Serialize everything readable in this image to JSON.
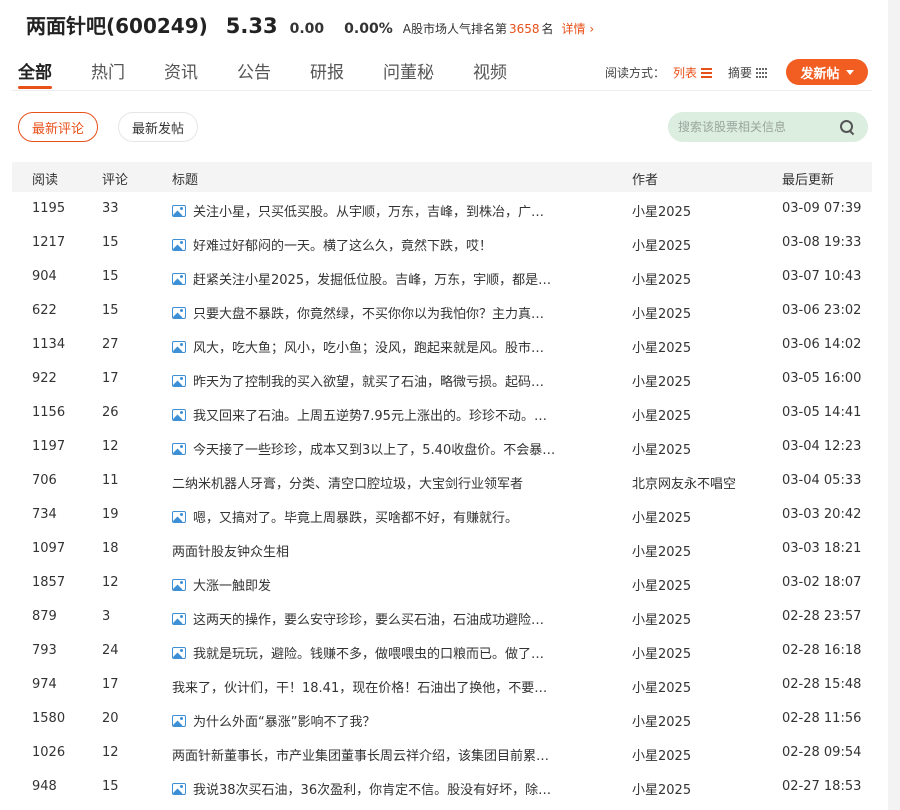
{
  "header": {
    "bar_title": "两面针吧(600249)",
    "price": "5.33",
    "change": "0.00",
    "change_pct": "0.00%",
    "rank_label": "A股市场人气排名第",
    "rank_num": "3658",
    "rank_unit": "名",
    "detail_link": "详情"
  },
  "tabs": [
    "全部",
    "热门",
    "资讯",
    "公告",
    "研报",
    "问董秘",
    "视频"
  ],
  "read_mode": {
    "label": "阅读方式：",
    "list": "列表",
    "summary": "摘要"
  },
  "post_button": "发新帖",
  "sort": {
    "latest_comment": "最新评论",
    "latest_post": "最新发帖"
  },
  "search": {
    "placeholder": "搜索该股票相关信息"
  },
  "columns": {
    "read": "阅读",
    "comment": "评论",
    "title": "标题",
    "author": "作者",
    "updated": "最后更新"
  },
  "posts": [
    {
      "read": "1195",
      "comment": "33",
      "title": "关注小星，只买低买股。从宇顺，万东，吉峰，到株冶，广…",
      "img": true,
      "author": "小星2025",
      "time": "03-09 07:39"
    },
    {
      "read": "1217",
      "comment": "15",
      "title": "好难过好郁闷的一天。横了这么久，竟然下跌，哎！",
      "img": true,
      "author": "小星2025",
      "time": "03-08 19:33"
    },
    {
      "read": "904",
      "comment": "15",
      "title": "赶紧关注小星2025，发掘低位股。吉峰，万东，宇顺，都是…",
      "img": true,
      "author": "小星2025",
      "time": "03-07 10:43"
    },
    {
      "read": "622",
      "comment": "15",
      "title": "只要大盘不暴跌，你竟然绿，不买你你以为我怕你？主力真…",
      "img": true,
      "author": "小星2025",
      "time": "03-06 23:02"
    },
    {
      "read": "1134",
      "comment": "27",
      "title": "风大，吃大鱼；风小，吃小鱼；没风，跑起来就是风。股市…",
      "img": true,
      "author": "小星2025",
      "time": "03-06 14:02"
    },
    {
      "read": "922",
      "comment": "17",
      "title": "昨天为了控制我的买入欲望，就买了石油，略微亏损。起码…",
      "img": true,
      "author": "小星2025",
      "time": "03-05 16:00"
    },
    {
      "read": "1156",
      "comment": "26",
      "title": "我又回来了石油。上周五逆势7.95元上涨出的。珍珍不动。…",
      "img": true,
      "author": "小星2025",
      "time": "03-05 14:41"
    },
    {
      "read": "1197",
      "comment": "12",
      "title": "今天接了一些珍珍，成本又到3以上了，5.40收盘价。不会暴…",
      "img": true,
      "author": "小星2025",
      "time": "03-04 12:23"
    },
    {
      "read": "706",
      "comment": "11",
      "title": "二纳米机器人牙膏，分类、清空口腔垃圾，大宝剑行业领军者",
      "img": false,
      "author": "北京网友永不唱空",
      "time": "03-04 05:33"
    },
    {
      "read": "734",
      "comment": "19",
      "title": "嗯，又搞对了。毕竟上周暴跌，买啥都不好，有赚就行。",
      "img": true,
      "author": "小星2025",
      "time": "03-03 20:42"
    },
    {
      "read": "1097",
      "comment": "18",
      "title": "两面针股友钟众生相",
      "img": false,
      "author": "小星2025",
      "time": "03-03 18:21"
    },
    {
      "read": "1857",
      "comment": "12",
      "title": "大涨一触即发",
      "img": true,
      "author": "小星2025",
      "time": "03-02 18:07"
    },
    {
      "read": "879",
      "comment": "3",
      "title": "这两天的操作，要么安守珍珍，要么买石油，石油成功避险…",
      "img": true,
      "author": "小星2025",
      "time": "02-28 23:57"
    },
    {
      "read": "793",
      "comment": "24",
      "title": "我就是玩玩，避险。钱赚不多，做喂喂虫的口粮而已。做了…",
      "img": true,
      "author": "小星2025",
      "time": "02-28 16:18"
    },
    {
      "read": "974",
      "comment": "17",
      "title": "我来了，伙计们，干！18.41，现在价格！石油出了换他，不要…",
      "img": false,
      "author": "小星2025",
      "time": "02-28 15:48"
    },
    {
      "read": "1580",
      "comment": "20",
      "title": "为什么外面“暴涨”影响不了我？",
      "img": true,
      "author": "小星2025",
      "time": "02-28 11:56"
    },
    {
      "read": "1026",
      "comment": "12",
      "title": "两面针新董事长，市产业集团董事长周云祥介绍，该集团目前累…",
      "img": false,
      "author": "小星2025",
      "time": "02-28 09:54"
    },
    {
      "read": "948",
      "comment": "15",
      "title": "我说38次买石油，36次盈利，你肯定不信。股没有好坏，除…",
      "img": true,
      "author": "小星2025",
      "time": "02-27 18:53"
    }
  ]
}
